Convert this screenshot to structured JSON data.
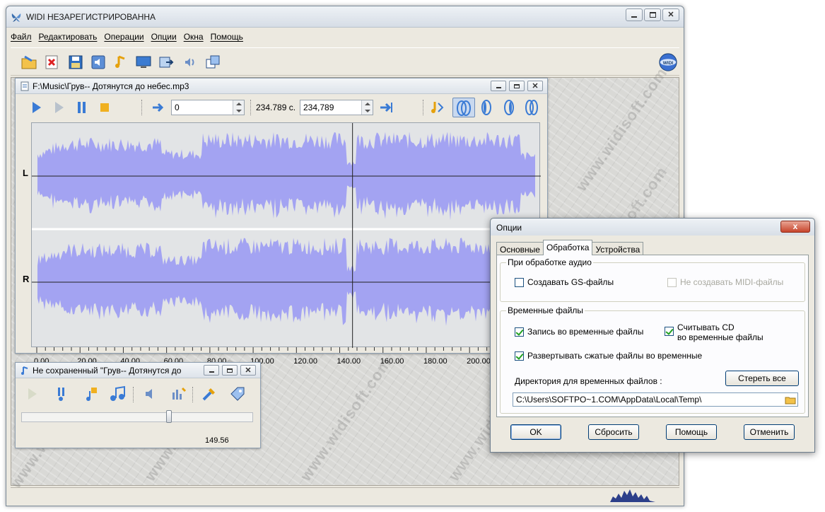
{
  "app": {
    "title": "WIDI НЕЗАРЕГИСТРИРОВАННА",
    "menu": [
      "Файл",
      "Редактировать",
      "Операции",
      "Опции",
      "Окна",
      "Помощь"
    ],
    "watermark_text": "www.widisoft.com"
  },
  "audio_window": {
    "title": "F:\\Music\\Грув-- Дотянутся до небес.mp3",
    "start_value": "0",
    "duration_readout": "234.789 c.",
    "end_value": "234,789",
    "channels": [
      "L",
      "R"
    ],
    "axis_ticks": [
      "0.00",
      "20.00",
      "40.00",
      "60.00",
      "80.00",
      "100.00",
      "120.00",
      "140.00",
      "160.00",
      "180.00",
      "200.00"
    ],
    "playhead_seconds": 145.6,
    "axis_max_seconds": 230,
    "waveform_color": "#a3a3f2"
  },
  "player_window": {
    "title": "Не сохраненный \"Грув-- Дотянутся до",
    "position_readout": "149.56",
    "position_fraction": 0.64
  },
  "options_dialog": {
    "title": "Опции",
    "close_label": "x",
    "tabs": [
      "Основные",
      "Обработка",
      "Устройства"
    ],
    "active_tab": 1,
    "group_audio": {
      "legend": "При обработке аудио",
      "create_gs": "Создавать GS-файлы",
      "no_midi": "Не создавать MIDI-файлы"
    },
    "group_temp": {
      "legend": "Временные файлы",
      "write_temp": "Запись во временные файлы",
      "read_cd_line1": "Считывать CD",
      "read_cd_line2": "во временные файлы",
      "expand_compressed": "Развертывать сжатые файлы во временные",
      "dir_label": "Директория для временных файлов :",
      "clear_button": "Стереть все",
      "path_value": "C:\\Users\\SOFTPO~1.COM\\AppData\\Local\\Temp\\"
    },
    "buttons": {
      "ok": "OK",
      "reset": "Сбросить",
      "help": "Помощь",
      "cancel": "Отменить"
    }
  }
}
